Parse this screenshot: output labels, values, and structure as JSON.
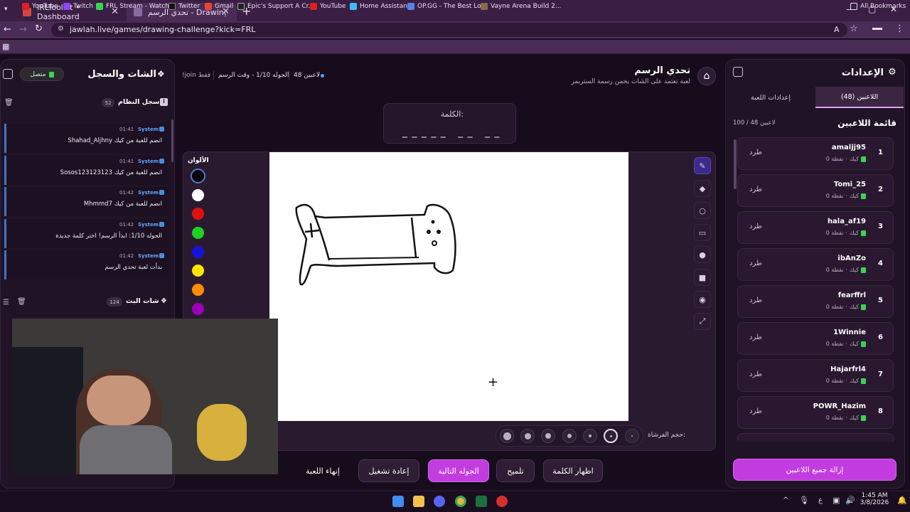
{
  "browser": {
    "tabs": [
      {
        "title": "IRLToolkit • Dashboard"
      },
      {
        "title": "تحدي الرسم - Drawing Challenge"
      }
    ],
    "url": "jawlah.live/games/drawing-challenge?kick=FRL",
    "bookmarks": [
      "YouTube",
      "Twitch",
      "FRL Stream - Watch...",
      "Twitter",
      "Gmail",
      "Epic's Support A Cr...",
      "YouTube",
      "Home Assistant",
      "OP.GG - The Best Lo...",
      "Vayne Arena Build 2..."
    ],
    "all_bookmarks": "All Bookmarks"
  },
  "header": {
    "title": "تحدي الرسم",
    "subtitle": "لعبة تعتمد على الشات يخمن رسمة الستريمر",
    "players_count": "48 لاعبين",
    "round_info": "الجوله 1/10 - وقت الرسم",
    "join_hint": "!join فقط"
  },
  "word": {
    "label": "الكلمة:",
    "mask": "_ _ _ _ _   _ _   _ _"
  },
  "colors": {
    "label": "الألوان",
    "swatches": [
      "#000000",
      "#ffffff",
      "#e01010",
      "#1fd11f",
      "#1414d8",
      "#ffe500",
      "#ff8c00",
      "#9b00b8"
    ]
  },
  "brush": {
    "label": "حجم الفرشاة:"
  },
  "game_buttons": {
    "end": "إنهاء اللعبة",
    "restart": "إعادة تشغيل",
    "next_round": "الجوله التالية",
    "hint": "تلميح",
    "reveal": "اظهار الكلمة"
  },
  "chat": {
    "title": "الشات والسجل",
    "status": "متصل",
    "system_log_title": "سجل النظام",
    "system_log_count": "52",
    "log": [
      {
        "time": "01:41",
        "who": "System",
        "msg": "Shahad_Aljhny انضم للعبة من كيك"
      },
      {
        "time": "01:41",
        "who": "System",
        "msg": "Sosos123123123 انضم للعبة من كيك"
      },
      {
        "time": "01:42",
        "who": "System",
        "msg": "Mhmmd7 انضم للعبة من كيك"
      },
      {
        "time": "01:42",
        "who": "System",
        "msg": "الجوله 1/10: ابدأ الرسم! اختر كلمة جديدة"
      },
      {
        "time": "01:42",
        "who": "System",
        "msg": "بدأت لعبة تحدي الرسم"
      }
    ],
    "stream_chat_title": "شات البث",
    "stream_chat_count": "124"
  },
  "settings": {
    "title": "الإعدادات",
    "tab_players": "اللاعبين (48)",
    "tab_game": "إعدادات اللعبة",
    "list_title": "قائمة اللاعبين",
    "list_count": "100 / 48 لاعبين",
    "kick_label": "طرد",
    "platform": "كيك",
    "points": "0 نقطة",
    "players": [
      {
        "rank": "1",
        "name": "amaljj95"
      },
      {
        "rank": "2",
        "name": "Tomi_25"
      },
      {
        "rank": "3",
        "name": "hala_af19"
      },
      {
        "rank": "4",
        "name": "ibAnZo"
      },
      {
        "rank": "5",
        "name": "fearffrl"
      },
      {
        "rank": "6",
        "name": "1Winnie"
      },
      {
        "rank": "7",
        "name": "Hajarfrl4"
      },
      {
        "rank": "8",
        "name": "POWR_Hazim"
      }
    ],
    "remove_all": "إزالة جميع اللاعبين"
  },
  "taskbar": {
    "lang": "ع",
    "time": "1:45 AM",
    "date": "3/8/2026"
  }
}
